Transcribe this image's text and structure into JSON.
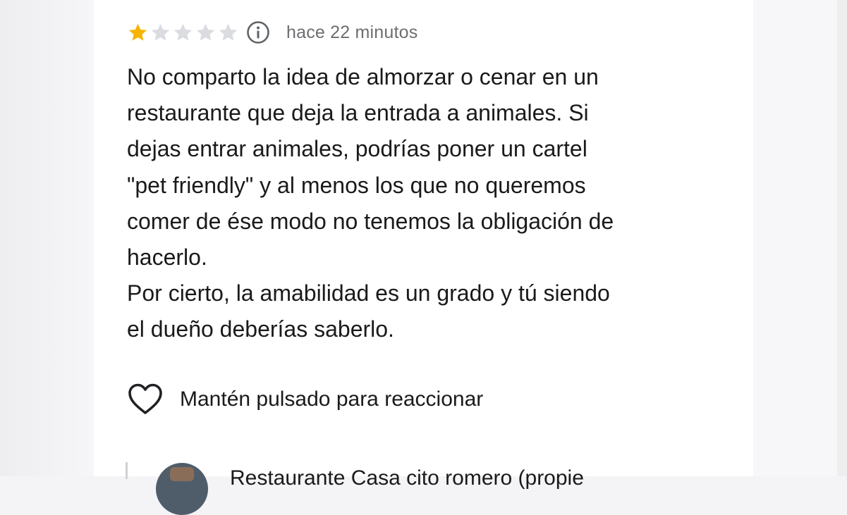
{
  "review": {
    "rating": 1,
    "max_rating": 5,
    "star_filled_color": "#F5B400",
    "star_empty_color": "#DADCE0",
    "timestamp": "hace 22 minutos",
    "body_lines": [
      "No comparto la idea de almorzar o cenar en un",
      "restaurante que deja la entrada a animales. Si",
      "dejas entrar animales, podrías poner un cartel",
      "\"pet friendly\" y al menos los que no queremos",
      "comer de ése modo no tenemos la obligación de",
      "hacerlo.",
      "Por cierto, la amabilidad es un grado y tú siendo",
      "el dueño deberías saberlo."
    ],
    "react_label": "Mantén pulsado para reaccionar",
    "icons": {
      "info": "info-circle-icon",
      "reaction": "heart-outline-icon"
    }
  },
  "reply": {
    "author": "Restaurante Casa cito romero (propie"
  }
}
